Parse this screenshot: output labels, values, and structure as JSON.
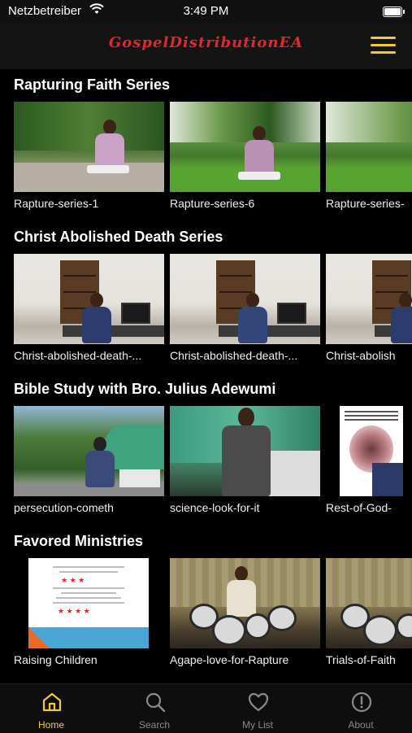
{
  "status_bar": {
    "carrier": "Netzbetreiber",
    "time": "3:49 PM",
    "wifi_icon": "wifi-icon",
    "battery_icon": "battery-full-icon"
  },
  "header": {
    "logo_text": "GospelDistributionEA",
    "menu_icon": "hamburger-menu-icon",
    "accent_color": "#f3c93f",
    "logo_color": "#e02828"
  },
  "sections": [
    {
      "title": "Rapturing Faith Series",
      "items": [
        {
          "title": "Rapture-series-1"
        },
        {
          "title": "Rapture-series-6"
        },
        {
          "title": "Rapture-series-"
        }
      ]
    },
    {
      "title": "Christ Abolished Death Series",
      "items": [
        {
          "title": "Christ-abolished-death-..."
        },
        {
          "title": "Christ-abolished-death-..."
        },
        {
          "title": "Christ-abolish"
        }
      ]
    },
    {
      "title": "Bible Study with Bro. Julius Adewumi",
      "items": [
        {
          "title": "persecution-cometh"
        },
        {
          "title": "science-look-for-it"
        },
        {
          "title": "Rest-of-God-"
        }
      ]
    },
    {
      "title": "Favored Ministries",
      "items": [
        {
          "title": "Raising Children"
        },
        {
          "title": "Agape-love-for-Rapture"
        },
        {
          "title": "Trials-of-Faith"
        }
      ]
    }
  ],
  "tabbar": {
    "tabs": [
      {
        "label": "Home",
        "icon": "home-icon",
        "active": true
      },
      {
        "label": "Search",
        "icon": "search-icon",
        "active": false
      },
      {
        "label": "My List",
        "icon": "heart-icon",
        "active": false
      },
      {
        "label": "About",
        "icon": "info-icon",
        "active": false
      }
    ]
  }
}
